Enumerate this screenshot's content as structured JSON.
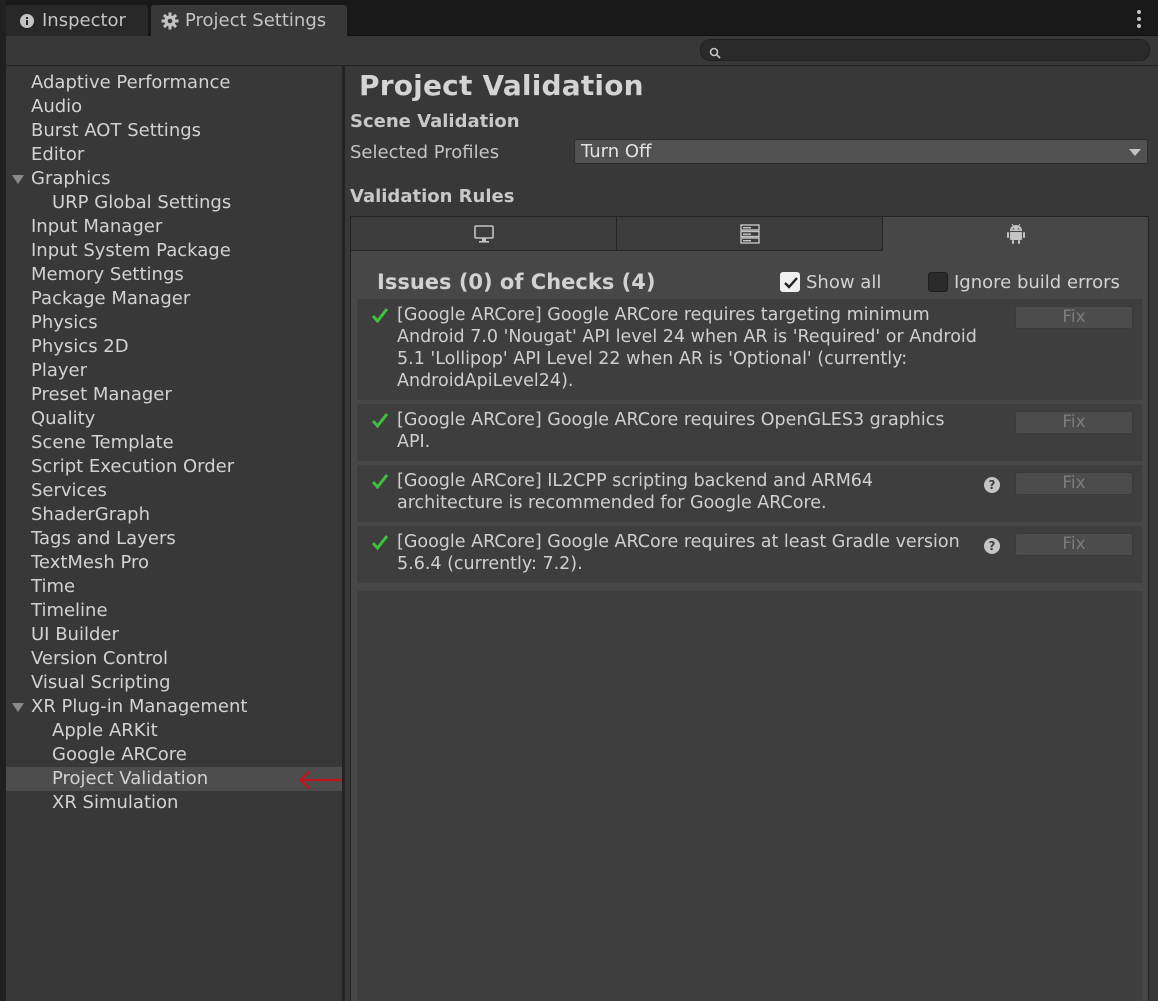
{
  "tabs": [
    {
      "label": "Inspector",
      "icon": "info-icon",
      "active": false
    },
    {
      "label": "Project Settings",
      "icon": "gear-icon",
      "active": true
    }
  ],
  "search": {
    "placeholder": "",
    "value": ""
  },
  "sidebar": {
    "items": [
      {
        "label": "Adaptive Performance"
      },
      {
        "label": "Audio"
      },
      {
        "label": "Burst AOT Settings"
      },
      {
        "label": "Editor"
      },
      {
        "label": "Graphics",
        "expanded": true
      },
      {
        "label": "URP Global Settings",
        "child": true
      },
      {
        "label": "Input Manager"
      },
      {
        "label": "Input System Package"
      },
      {
        "label": "Memory Settings"
      },
      {
        "label": "Package Manager"
      },
      {
        "label": "Physics"
      },
      {
        "label": "Physics 2D"
      },
      {
        "label": "Player"
      },
      {
        "label": "Preset Manager"
      },
      {
        "label": "Quality"
      },
      {
        "label": "Scene Template"
      },
      {
        "label": "Script Execution Order"
      },
      {
        "label": "Services"
      },
      {
        "label": "ShaderGraph"
      },
      {
        "label": "Tags and Layers"
      },
      {
        "label": "TextMesh Pro"
      },
      {
        "label": "Time"
      },
      {
        "label": "Timeline"
      },
      {
        "label": "UI Builder"
      },
      {
        "label": "Version Control"
      },
      {
        "label": "Visual Scripting"
      },
      {
        "label": "XR Plug-in Management",
        "expanded": true
      },
      {
        "label": "Apple ARKit",
        "child": true
      },
      {
        "label": "Google ARCore",
        "child": true
      },
      {
        "label": "Project Validation",
        "child": true,
        "selected": true
      },
      {
        "label": "XR Simulation",
        "child": true
      }
    ]
  },
  "main": {
    "title": "Project Validation",
    "scene_validation": {
      "heading": "Scene Validation",
      "profiles_label": "Selected Profiles",
      "profiles_value": "Turn Off"
    },
    "validation_rules": {
      "heading": "Validation Rules",
      "platform_tabs": [
        {
          "icon": "monitor-icon",
          "active": false
        },
        {
          "icon": "server-icon",
          "active": false
        },
        {
          "icon": "android-icon",
          "active": true
        }
      ],
      "issues_title": "Issues (0) of Checks (4)",
      "show_all_label": "Show all",
      "show_all_checked": true,
      "ignore_errors_label": "Ignore build errors",
      "ignore_errors_checked": false,
      "rules": [
        {
          "text": "[Google ARCore] Google ARCore requires targeting minimum Android 7.0 'Nougat' API level 24 when AR is 'Required' or Android 5.1 'Lollipop' API Level 22 when AR is 'Optional' (currently: AndroidApiLevel24).",
          "fix_label": "Fix",
          "has_help": false
        },
        {
          "text": "[Google ARCore] Google ARCore requires OpenGLES3 graphics API.",
          "fix_label": "Fix",
          "has_help": false
        },
        {
          "text": "[Google ARCore] IL2CPP scripting backend and ARM64 architecture is recommended for Google ARCore.",
          "fix_label": "Fix",
          "has_help": true
        },
        {
          "text": "[Google ARCore] Google ARCore requires at least Gradle version 5.6.4 (currently: 7.2).",
          "fix_label": "Fix",
          "has_help": true
        }
      ]
    }
  },
  "colors": {
    "accent_check": "#3fbf3f",
    "annotation_arrow": "#c0161b"
  }
}
